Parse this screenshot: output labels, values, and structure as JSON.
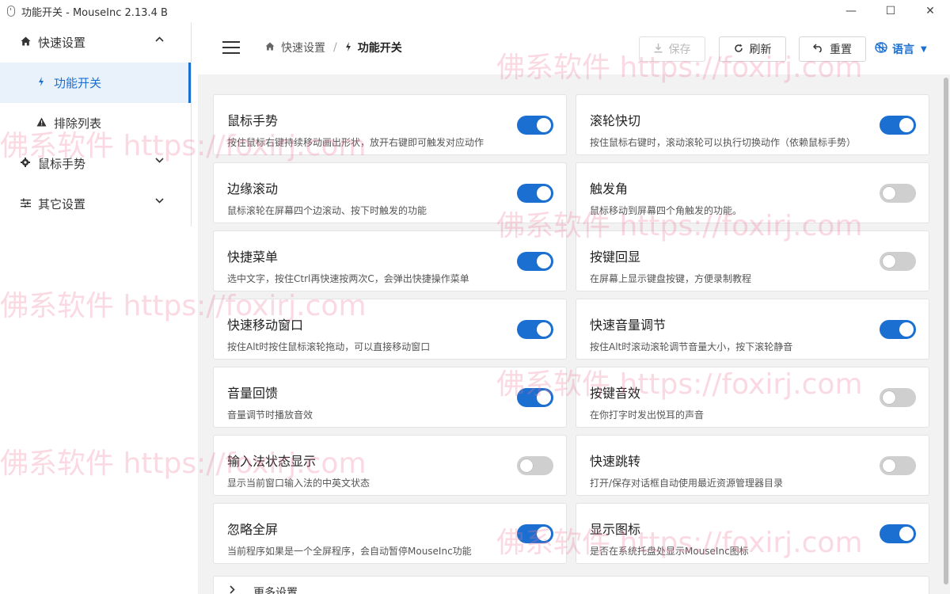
{
  "window": {
    "title": "功能开关 - MouseInc 2.13.4 B",
    "controls": [
      "—",
      "☐",
      "✕"
    ]
  },
  "sidebar": {
    "items": [
      {
        "label": "快速设置",
        "icon": "home-icon",
        "expanded": true
      },
      {
        "label": "功能开关",
        "icon": "lightning-icon",
        "active": true
      },
      {
        "label": "排除列表",
        "icon": "warning-icon"
      },
      {
        "label": "鼠标手势",
        "icon": "gear-icon",
        "expanded": false
      },
      {
        "label": "其它设置",
        "icon": "sliders-icon",
        "expanded": false
      }
    ]
  },
  "header": {
    "breadcrumb": [
      "快速设置",
      "功能开关"
    ],
    "save_label": "保存",
    "refresh_label": "刷新",
    "reset_label": "重置",
    "language_label": "语言"
  },
  "cards": [
    {
      "title": "鼠标手势",
      "desc": "按住鼠标右键持续移动画出形状，放开右键即可触发对应动作",
      "on": true
    },
    {
      "title": "滚轮快切",
      "desc": "按住鼠标右键时，滚动滚轮可以执行切换动作（依赖鼠标手势）",
      "on": true
    },
    {
      "title": "边缘滚动",
      "desc": "鼠标滚轮在屏幕四个边滚动、按下时触发的功能",
      "on": true
    },
    {
      "title": "触发角",
      "desc": "鼠标移动到屏幕四个角触发的功能。",
      "on": false
    },
    {
      "title": "快捷菜单",
      "desc": "选中文字，按住Ctrl再快速按两次C，会弹出快捷操作菜单",
      "on": true
    },
    {
      "title": "按键回显",
      "desc": "在屏幕上显示键盘按键，方便录制教程",
      "on": false
    },
    {
      "title": "快速移动窗口",
      "desc": "按住Alt时按住鼠标滚轮拖动，可以直接移动窗口",
      "on": true
    },
    {
      "title": "快速音量调节",
      "desc": "按住Alt时滚动滚轮调节音量大小，按下滚轮静音",
      "on": true
    },
    {
      "title": "音量回馈",
      "desc": "音量调节时播放音效",
      "on": true
    },
    {
      "title": "按键音效",
      "desc": "在你打字时发出悦耳的声音",
      "on": false
    },
    {
      "title": "输入法状态显示",
      "desc": "显示当前窗口输入法的中英文状态",
      "on": false
    },
    {
      "title": "快速跳转",
      "desc": "打开/保存对话框自动使用最近资源管理器目录",
      "on": false
    },
    {
      "title": "忽略全屏",
      "desc": "当前程序如果是一个全屏程序，会自动暂停MouseInc功能",
      "on": true
    },
    {
      "title": "显示图标",
      "desc": "是否在系统托盘处显示MouseInc图标",
      "on": true
    }
  ],
  "more_settings_label": "更多设置",
  "watermark": "佛系软件 https://foxirj.com",
  "colors": {
    "accent": "#1b6fd1",
    "toggle_off": "#cfcfcf",
    "content_bg": "#f2f2f2"
  }
}
